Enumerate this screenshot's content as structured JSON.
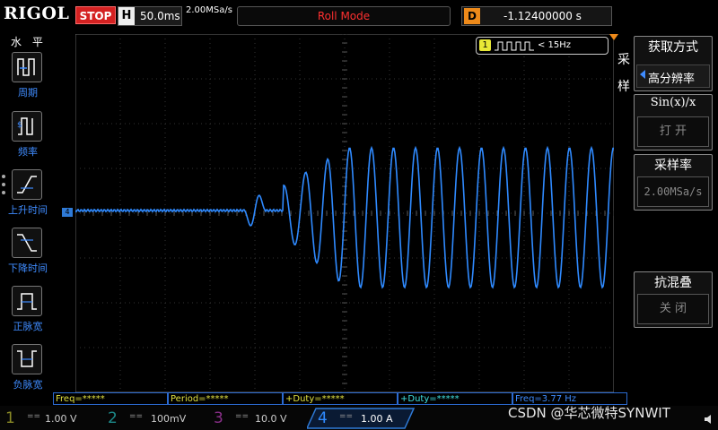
{
  "topbar": {
    "logo": "RIGOL",
    "run_status": "STOP",
    "timebase_label": "H",
    "timebase_value": "50.0ms",
    "sample_rate": "2.00MSa/s",
    "mode": "Roll Mode",
    "delay_label": "D",
    "delay_value": "-1.12400000 s"
  },
  "left_menu": {
    "title": "水 平",
    "items": [
      {
        "label": "周期",
        "icon": "period-icon"
      },
      {
        "label": "频率",
        "icon": "frequency-icon"
      },
      {
        "label": "上升时间",
        "icon": "rise-time-icon"
      },
      {
        "label": "下降时间",
        "icon": "fall-time-icon"
      },
      {
        "label": "正脉宽",
        "icon": "positive-pulse-width-icon"
      },
      {
        "label": "负脉宽",
        "icon": "negative-pulse-width-icon"
      }
    ]
  },
  "trigger": {
    "source_num": "1",
    "condition": "< 15Hz"
  },
  "right_menu": {
    "side_label": "采样",
    "items": [
      {
        "title": "获取方式",
        "value": "高分辨率"
      },
      {
        "title": "Sin(x)/x",
        "value": "打 开"
      },
      {
        "title": "采样率",
        "value": "2.00MSa/s"
      },
      {
        "title": "抗混叠",
        "value": "关 闭"
      }
    ]
  },
  "measurements": [
    {
      "text": "Freq=*****",
      "color": "#e0e040"
    },
    {
      "text": "Period=*****",
      "color": "#e0e040"
    },
    {
      "text": "+Duty=*****",
      "color": "#e0e040"
    },
    {
      "text": "+Duty=*****",
      "color": "#40e0e0"
    },
    {
      "text": "Freq=3.77 Hz",
      "color": "#3f8cff"
    }
  ],
  "channels": [
    {
      "num": "1",
      "value": "1.00 V",
      "color": "#e8e836"
    },
    {
      "num": "2",
      "value": "100mV",
      "color": "#27c9c9"
    },
    {
      "num": "3",
      "value": "10.0 V",
      "color": "#cc44cc"
    },
    {
      "num": "4",
      "value": "1.00 A",
      "color": "#2f7ad6"
    }
  ],
  "channel_marker": "4",
  "watermark": "CSDN @华芯微特SYNWIT",
  "colors": {
    "trace": "#2f8aff",
    "accent": "#ee8a1a",
    "stop": "#d42121"
  }
}
